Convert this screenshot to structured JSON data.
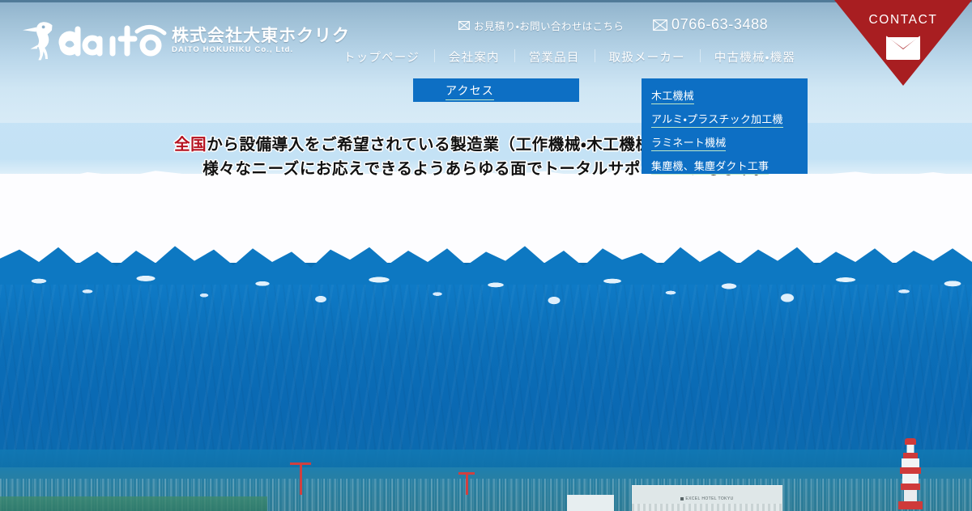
{
  "site": {
    "logo": {
      "mark": "woodpecker-bird-logo",
      "wordmark": "daito",
      "company_jp": "株式会社大東ホクリク",
      "company_en": "DAITO HOKURIKU Co., Ltd."
    },
    "contact_row": {
      "inquiry": {
        "icon": "envelope-outline-icon",
        "label": "お見積り・お問い合わせはこちら"
      },
      "phone": {
        "icon": "envelope-outline-icon",
        "label": "0766-63-3488"
      }
    },
    "nav": [
      {
        "label": "トップページ"
      },
      {
        "label": "会社案内"
      },
      {
        "label": "営業品目"
      },
      {
        "label": "取扱メーカー"
      },
      {
        "label": "中古機械・機器"
      }
    ],
    "access": {
      "label": "アクセス"
    },
    "dropdown": {
      "items": [
        {
          "label": "木工機械"
        },
        {
          "label": "アルミ・プラスチック加工機"
        },
        {
          "label": "ラミネート機械"
        },
        {
          "label": "集塵機、集塵ダクト工事"
        }
      ]
    },
    "contact_badge": {
      "label": "CONTACT",
      "icon": "mail-envelope-icon"
    },
    "headline": {
      "lead": "全国",
      "line1_rest": "から設備導入をご希望されている製造業（工作機械・木工機械など）のお客様に、",
      "line2": "様々なニーズにお応えできるようあらゆる面でトータルサポートいたします。"
    },
    "photo": {
      "hotel_label": "EXCEL HOTEL TOKYU"
    },
    "colors": {
      "accent_blue": "#0d6fc4",
      "contact_red": "#a81e21",
      "headline_red": "#b5111f",
      "sky": "#c6e3f6",
      "mountain": "#0b6fb9"
    }
  }
}
